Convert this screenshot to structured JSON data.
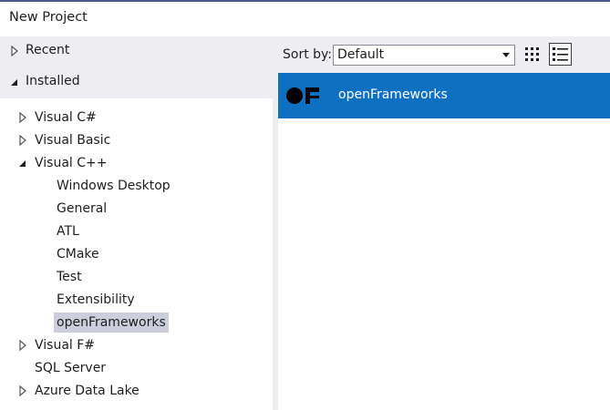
{
  "window": {
    "title": "New Project"
  },
  "sidebar": {
    "recent": {
      "label": "Recent",
      "expanded": false
    },
    "installed": {
      "label": "Installed",
      "expanded": true
    },
    "tree": [
      {
        "label": "Visual C#",
        "expander": "collapsed"
      },
      {
        "label": "Visual Basic",
        "expander": "collapsed"
      },
      {
        "label": "Visual C++",
        "expander": "expanded"
      },
      {
        "label": "Windows Desktop",
        "expander": "none"
      },
      {
        "label": "General",
        "expander": "none"
      },
      {
        "label": "ATL",
        "expander": "none"
      },
      {
        "label": "CMake",
        "expander": "none"
      },
      {
        "label": "Test",
        "expander": "none"
      },
      {
        "label": "Extensibility",
        "expander": "none"
      },
      {
        "label": "openFrameworks",
        "expander": "none",
        "selected": true
      },
      {
        "label": "Visual F#",
        "expander": "collapsed"
      },
      {
        "label": "SQL Server",
        "expander": "none"
      },
      {
        "label": "Azure Data Lake",
        "expander": "collapsed"
      }
    ]
  },
  "toolbar": {
    "sort_label": "Sort by:",
    "sort_value": "Default",
    "grid_view_icon": "grid-view-icon",
    "list_view_icon": "list-view-icon",
    "active_view": "list"
  },
  "templates": [
    {
      "name": "openFrameworks",
      "icon": "openframeworks-logo-icon",
      "selected": true
    }
  ],
  "colors": {
    "selection_blue": "#0e70c0",
    "tree_selection": "#cccedb",
    "chrome_background": "#eeeef2",
    "title_accent": "#4a5a8c"
  }
}
